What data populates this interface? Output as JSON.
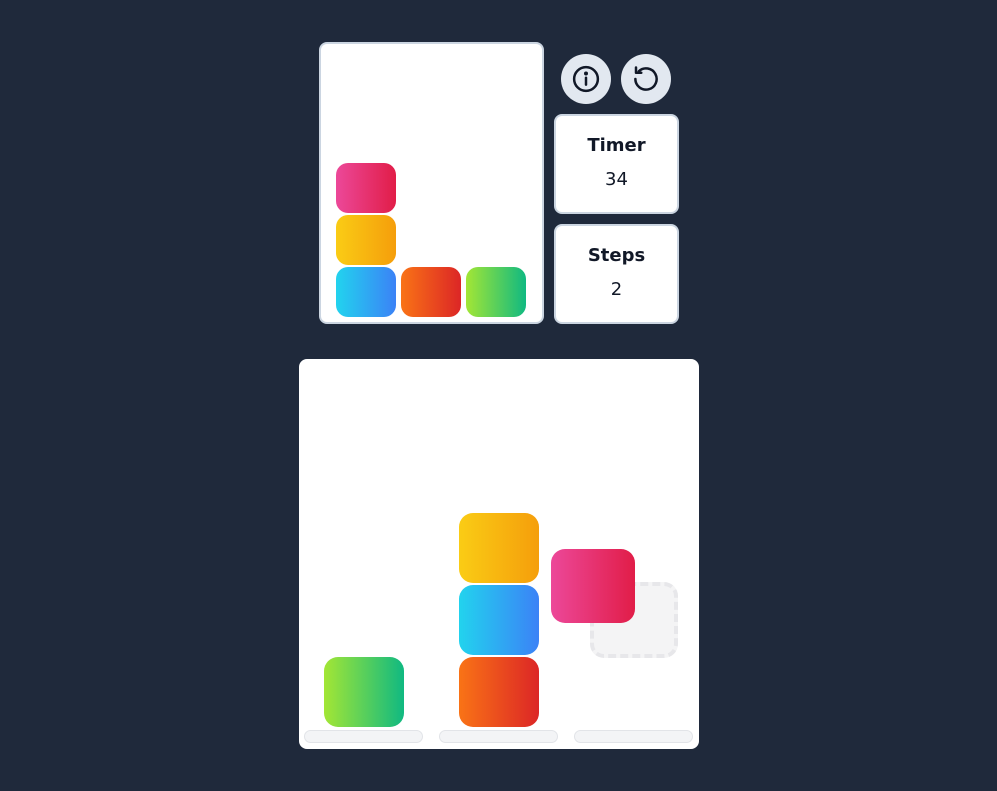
{
  "icons": {
    "info": "info-icon",
    "reset": "reset-icon"
  },
  "timer": {
    "label": "Timer",
    "value": "34"
  },
  "steps": {
    "label": "Steps",
    "value": "2"
  },
  "colors": {
    "pink": [
      "#ec4899",
      "#e11d48"
    ],
    "yellow": [
      "#facc15",
      "#f59e0b"
    ],
    "blue": [
      "#22d3ee",
      "#3b82f6"
    ],
    "orange": [
      "#f97316",
      "#dc2626"
    ],
    "green": [
      "#a3e635",
      "#10b981"
    ]
  },
  "target": {
    "columns": [
      [
        "blue",
        "yellow",
        "pink"
      ],
      [
        "orange"
      ],
      [
        "green"
      ]
    ]
  },
  "board": {
    "columns": [
      [
        "green"
      ],
      [
        "orange",
        "blue",
        "yellow"
      ],
      []
    ],
    "held_block": "pink",
    "drop_column": 3
  }
}
